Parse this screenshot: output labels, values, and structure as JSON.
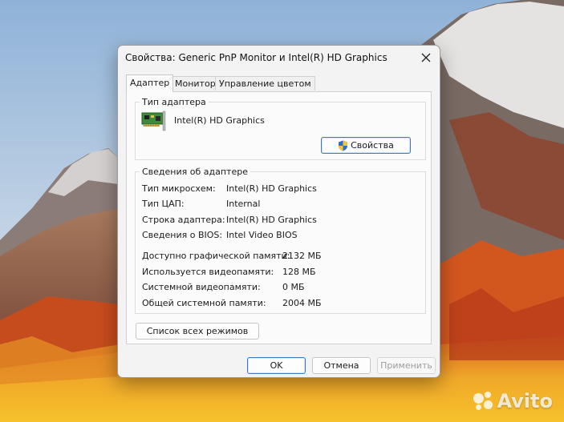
{
  "window": {
    "title": "Свойства: Generic PnP Monitor и Intel(R) HD Graphics",
    "close_label": "✕"
  },
  "tabs": [
    {
      "label": "Адаптер",
      "active": true
    },
    {
      "label": "Монитор",
      "active": false
    },
    {
      "label": "Управление цветом",
      "active": false
    }
  ],
  "adapter_type": {
    "group_label": "Тип адаптера",
    "name": "Intel(R) HD Graphics",
    "properties_button": "Свойства",
    "icon": "display-adapter-card-icon",
    "button_icon": "uac-shield-icon"
  },
  "adapter_info": {
    "group_label": "Сведения об адаптере",
    "rows": [
      {
        "label": "Тип микросхем:",
        "value": "Intel(R) HD Graphics"
      },
      {
        "label": "Тип ЦАП:",
        "value": "Internal"
      },
      {
        "label": "Строка адаптера:",
        "value": "Intel(R) HD Graphics"
      },
      {
        "label": "Сведения о BIOS:",
        "value": "Intel Video BIOS"
      }
    ],
    "memory_rows": [
      {
        "label": "Доступно графической памяти:",
        "value": "2132 МБ"
      },
      {
        "label": "Используется видеопамяти:",
        "value": "128 МБ"
      },
      {
        "label": "Системной видеопамяти:",
        "value": "0 МБ"
      },
      {
        "label": "Общей системной памяти:",
        "value": "2004 МБ"
      }
    ]
  },
  "list_modes_button": "Список всех режимов",
  "footer": {
    "ok": "OK",
    "cancel": "Отмена",
    "apply": "Применить"
  },
  "watermark": {
    "text": "Avito"
  },
  "colors": {
    "accent": "#3b79c4",
    "dialog_bg": "#f3f3f3",
    "panel_bg": "#fbfbfb",
    "disabled_text": "#9d9d9d"
  }
}
